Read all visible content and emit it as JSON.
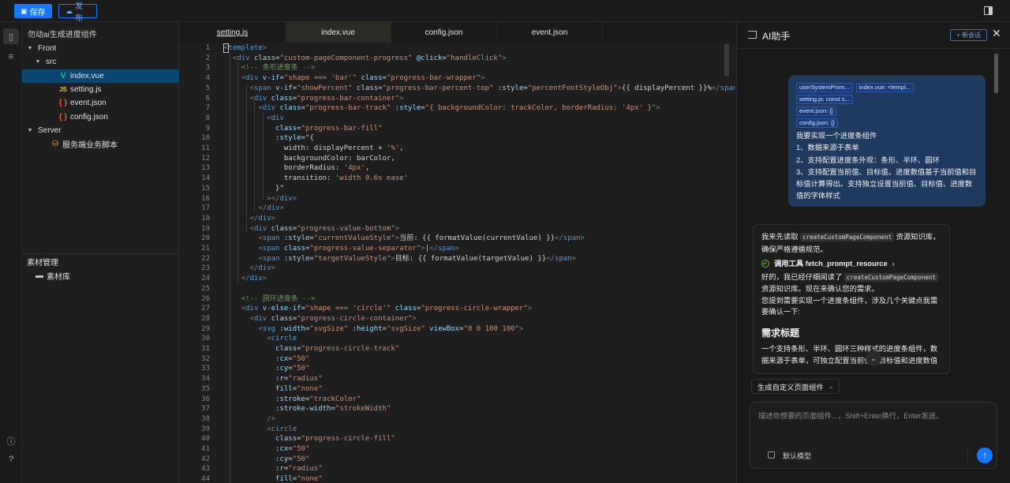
{
  "toolbar": {
    "save_label": "保存",
    "publish_label": "发布",
    "save_icon": "save-icon",
    "publish_icon": "cloud-upload-icon"
  },
  "explorer": {
    "project_title": "勿动ai生成进度组件",
    "tree": [
      {
        "label": "Front",
        "type": "folder",
        "indent": 0,
        "expanded": true
      },
      {
        "label": "src",
        "type": "folder",
        "indent": 1,
        "expanded": true
      },
      {
        "label": "index.vue",
        "type": "vue",
        "indent": 2,
        "selected": true
      },
      {
        "label": "setting.js",
        "type": "js",
        "indent": 2
      },
      {
        "label": "event.json",
        "type": "json",
        "indent": 2
      },
      {
        "label": "config.json",
        "type": "json",
        "indent": 2
      },
      {
        "label": "Server",
        "type": "folder",
        "indent": 0,
        "expanded": true
      },
      {
        "label": "服务端业务脚本",
        "type": "script",
        "indent": 1
      }
    ],
    "materials_section": "素材管理",
    "materials_item": "素材库"
  },
  "editor": {
    "tabs": [
      {
        "label": "setting.js",
        "active": false
      },
      {
        "label": "index.vue",
        "active": true
      },
      {
        "label": "config.json",
        "active": false
      },
      {
        "label": "event.json",
        "active": false
      }
    ],
    "lines": [
      "<template>",
      "  <div class=\"custom-pageComponent-progress\" @click=\"handleClick\">",
      "    <!-- 条形进度条 -->",
      "    <div v-if=\"shape === 'bar'\" class=\"progress-bar-wrapper\">",
      "      <span v-if=\"showPercent\" class=\"progress-bar-percent-top\" :style=\"percentFontStyleObj\">{{ displayPercent }}%</span>",
      "      <div class=\"progress-bar-container\">",
      "        <div class=\"progress-bar-track\" :style=\"{ backgroundColor: trackColor, borderRadius: '4px' }\">",
      "          <div",
      "            class=\"progress-bar-fill\"",
      "            :style=\"{",
      "              width: displayPercent + '%',",
      "              backgroundColor: barColor,",
      "              borderRadius: '4px',",
      "              transition: 'width 0.6s ease'",
      "            }\"",
      "          ></div>",
      "        </div>",
      "      </div>",
      "      <div class=\"progress-value-bottom\">",
      "        <span :style=\"currentValueStyle\">当前: {{ formatValue(currentValue) }}</span>",
      "        <span class=\"progress-value-separator\">|</span>",
      "        <span :style=\"targetValueStyle\">目标: {{ formatValue(targetValue) }}</span>",
      "      </div>",
      "    </div>",
      "",
      "    <!-- 圆环进度条 -->",
      "    <div v-else-if=\"shape === 'circle'\" class=\"progress-circle-wrapper\">",
      "      <div class=\"progress-circle-container\">",
      "        <svg :width=\"svgSize\" :height=\"svgSize\" viewBox=\"0 0 100 100\">",
      "          <circle",
      "            class=\"progress-circle-track\"",
      "            :cx=\"50\"",
      "            :cy=\"50\"",
      "            :r=\"radius\"",
      "            fill=\"none\"",
      "            :stroke=\"trackColor\"",
      "            :stroke-width=\"strokeWidth\"",
      "          />",
      "          <circle",
      "            class=\"progress-circle-fill\"",
      "            :cx=\"50\"",
      "            :cy=\"50\"",
      "            :r=\"radius\"",
      "            fill=\"none\""
    ]
  },
  "ai": {
    "title": "AI助手",
    "new_chat": "+ 新会话",
    "context_chips": [
      [
        "userSystemProm...",
        "index.vue: <templ..."
      ],
      [
        "setting.js: const s..."
      ],
      [
        "event.json: []"
      ],
      [
        "config.json: {}"
      ]
    ],
    "user_message": [
      "我要实现一个进度条组件",
      "1、数据来源于表单",
      "2、支持配置进度条外观：条形、半环、圆环",
      "3、支持配置当前值、目标值。进度数值基于当前值和目标值计算得出。支持独立设置当前值、目标值、进度数值的字体样式"
    ],
    "assistant": {
      "intro_before": "我来先读取",
      "intro_code": "createCustomPageComponent",
      "intro_after": "资源知识库，确保严格遵循规范。",
      "tool_call": "调用工具 fetch_prompt_resource",
      "read_before": "好的，我已经仔细阅读了",
      "read_code": "createCustomPageComponent",
      "read_after": "资源知识库。现在来确认您的需求。",
      "confirm": "您提到需要实现一个进度条组件，涉及几个关键点我需要确认一下:",
      "heading": "需求标题",
      "summary": "一个支持条形、半环、圆环三种样式的进度条组件，数据来源于表单，可独立配置当前值、目标值和进度数值"
    },
    "mode_select": "生成自定义页面组件",
    "input_placeholder": "描述你想要的页面组件...，Shift+Enter换行，Enter发送。",
    "model_label": "默认模型"
  }
}
